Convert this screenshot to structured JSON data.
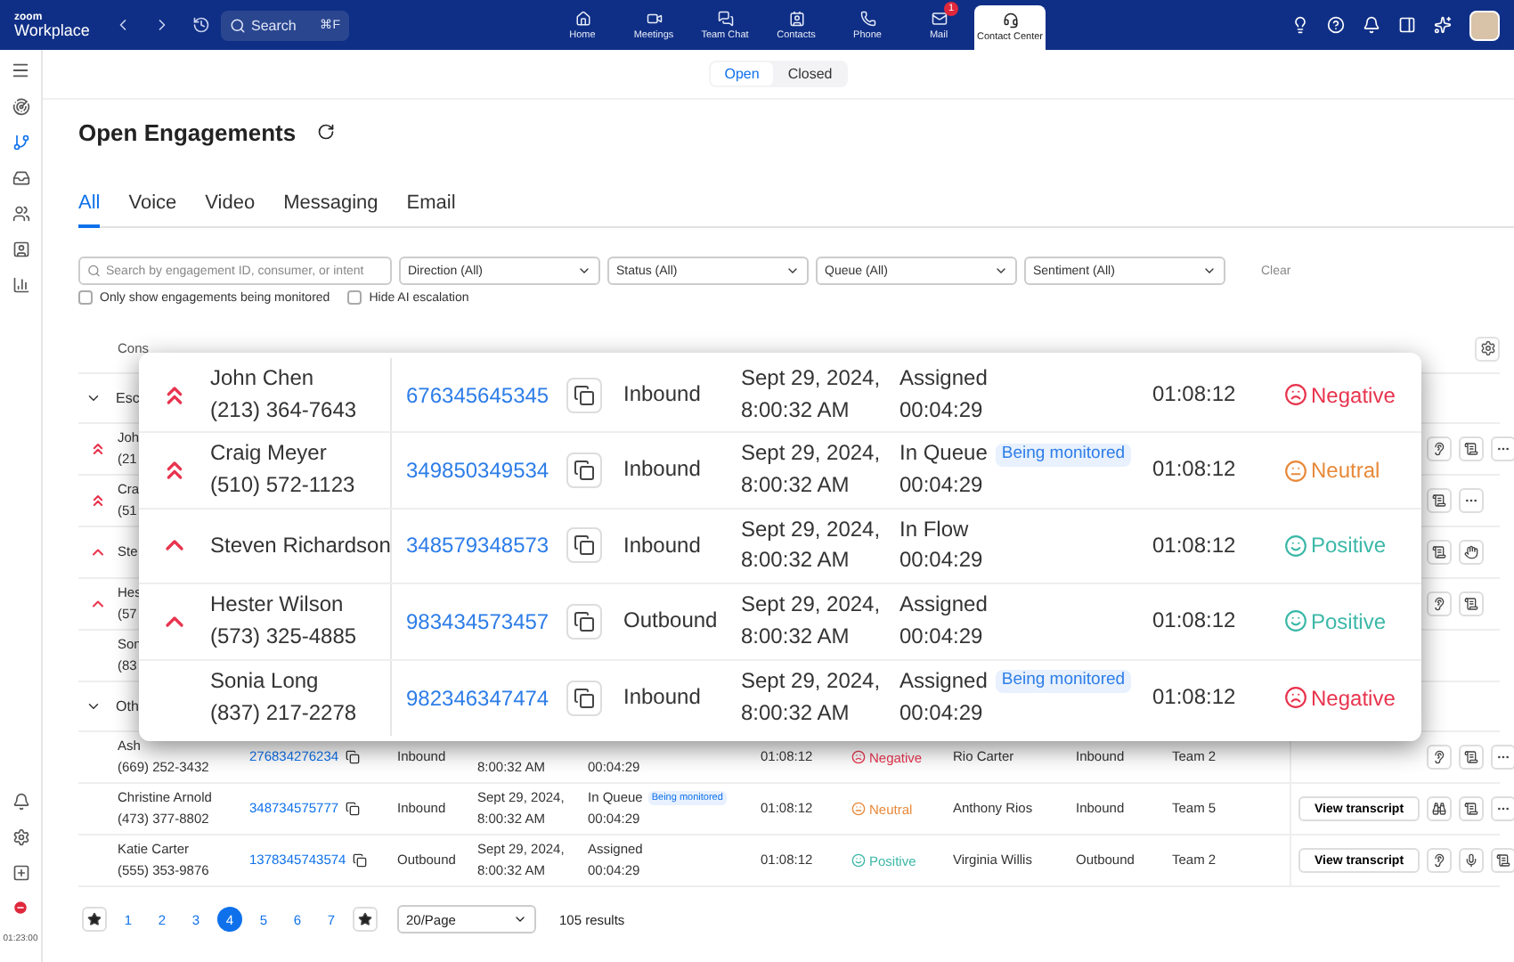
{
  "topbar": {
    "logo_top": "zoom",
    "logo_bottom": "Workplace",
    "search": {
      "placeholder": "Search",
      "shortcut": "⌘F"
    },
    "nav": [
      {
        "label": "Home",
        "selected": false
      },
      {
        "label": "Meetings",
        "selected": false
      },
      {
        "label": "Team Chat",
        "selected": false
      },
      {
        "label": "Contacts",
        "selected": false
      },
      {
        "label": "Phone",
        "selected": false
      },
      {
        "label": "Mail",
        "selected": false,
        "badge": "1"
      },
      {
        "label": "Contact Center",
        "selected": true
      }
    ]
  },
  "sidebar": {
    "items": [
      {
        "selected": false
      },
      {
        "selected": true
      },
      {
        "selected": false
      },
      {
        "selected": false
      },
      {
        "selected": false
      },
      {
        "selected": false
      }
    ],
    "status_time": "01:23:00"
  },
  "view_toggle": [
    {
      "label": "Open",
      "selected": true
    },
    {
      "label": "Closed",
      "selected": false
    }
  ],
  "title": "Open Engagements",
  "tabs": [
    {
      "label": "All",
      "selected": true
    },
    {
      "label": "Voice",
      "selected": false
    },
    {
      "label": "Video",
      "selected": false
    },
    {
      "label": "Messaging",
      "selected": false
    },
    {
      "label": "Email",
      "selected": false
    }
  ],
  "filters": {
    "search": {
      "placeholder": "Search by engagement ID, consumer, or intent"
    },
    "dropdowns": [
      "Direction (All)",
      "Status (All)",
      "Queue (All)",
      "Sentiment (All)"
    ],
    "clear": "Clear"
  },
  "checkboxes": [
    {
      "label": "Only show engagements being monitored",
      "checked": false
    },
    {
      "label": "Hide AI escalation",
      "checked": false
    }
  ],
  "table": {
    "header": "Cons",
    "rows": [
      {
        "kind": "group",
        "label": "Esc",
        "expanded": true
      },
      {
        "kind": "engagement",
        "priority": {
          "kind": "double"
        },
        "name": "Joh",
        "phone": "(21",
        "actions": [
          {
            "kind": "ear"
          },
          {
            "kind": "transcript"
          },
          {
            "kind": "more"
          }
        ]
      },
      {
        "kind": "engagement",
        "priority": {
          "kind": "double"
        },
        "name": "Cra",
        "phone": "(51",
        "actions": [
          {
            "kind": "transcript"
          },
          {
            "kind": "more"
          }
        ]
      },
      {
        "kind": "engagement",
        "priority": {
          "kind": "single"
        },
        "name": "Ste",
        "actions": [
          {
            "kind": "transcript"
          },
          {
            "kind": "hand"
          }
        ]
      },
      {
        "kind": "engagement",
        "priority": {
          "kind": "single"
        },
        "name": "Hes",
        "phone": "(57",
        "actions": [
          {
            "kind": "ear"
          },
          {
            "kind": "transcript"
          }
        ]
      },
      {
        "kind": "engagement",
        "name": "Son",
        "phone": "(83"
      },
      {
        "kind": "group",
        "label": "Oth",
        "expanded": true
      },
      {
        "kind": "engagement",
        "name": "Ash",
        "phone": "(669) 252-3432",
        "id": "276834276234",
        "direction": "Inbound",
        "date2": "8:00:32 AM",
        "status_time": "00:04:29",
        "duration": "01:08:12",
        "sentiment": {
          "kind": "negative",
          "label": "Negative"
        },
        "agent": "Rio Carter",
        "direction2": "Inbound",
        "team": "Team 2",
        "actions": [
          {
            "kind": "ear"
          },
          {
            "kind": "transcript"
          },
          {
            "kind": "more"
          }
        ]
      },
      {
        "kind": "engagement",
        "name": "Christine Arnold",
        "phone": "(473) 377-8802",
        "id": "348734575777",
        "direction": "Inbound",
        "date1": "Sept 29, 2024,",
        "date2": "8:00:32 AM",
        "status": "In Queue",
        "badge": "Being monitored",
        "status_time": "00:04:29",
        "duration": "01:08:12",
        "sentiment": {
          "kind": "neutral",
          "label": "Neutral"
        },
        "agent": "Anthony Rios",
        "direction2": "Inbound",
        "team": "Team 5",
        "actions": [
          {
            "kind": "button",
            "label": "View transcript"
          },
          {
            "kind": "binoculars"
          },
          {
            "kind": "transcript"
          },
          {
            "kind": "more"
          }
        ]
      },
      {
        "kind": "engagement",
        "name": "Katie Carter",
        "phone": "(555) 353-9876",
        "id": "1378345743574",
        "direction": "Outbound",
        "date1": "Sept 29, 2024,",
        "date2": "8:00:32 AM",
        "status": "Assigned",
        "status_time": "00:04:29",
        "duration": "01:08:12",
        "sentiment": {
          "kind": "positive",
          "label": "Positive"
        },
        "agent": "Virginia Willis",
        "direction2": "Outbound",
        "team": "Team 2",
        "actions": [
          {
            "kind": "button",
            "label": "View transcript"
          },
          {
            "kind": "ear"
          },
          {
            "kind": "mic"
          },
          {
            "kind": "transcript"
          }
        ]
      }
    ]
  },
  "popup": {
    "rows": [
      {
        "kind": "double",
        "name": "John Chen",
        "phone": "(213) 364-7643",
        "id": "676345645345",
        "direction": "Inbound",
        "date1": "Sept 29, 2024,",
        "date2": "8:00:32 AM",
        "status": "Assigned",
        "status_time": "00:04:29",
        "duration": "01:08:12",
        "sentiment": {
          "kind": "negative",
          "label": "Negative"
        }
      },
      {
        "kind": "double",
        "name": "Craig Meyer",
        "phone": "(510) 572-1123",
        "id": "349850349534",
        "direction": "Inbound",
        "date1": "Sept 29, 2024,",
        "date2": "8:00:32 AM",
        "status": "In Queue",
        "badge": "Being monitored",
        "status_time": "00:04:29",
        "duration": "01:08:12",
        "sentiment": {
          "kind": "neutral",
          "label": "Neutral"
        }
      },
      {
        "kind": "single",
        "name": "Steven Richardson",
        "id": "348579348573",
        "direction": "Inbound",
        "date1": "Sept 29, 2024,",
        "date2": "8:00:32 AM",
        "status": "In Flow",
        "status_time": "00:04:29",
        "duration": "01:08:12",
        "sentiment": {
          "kind": "positive",
          "label": "Positive"
        }
      },
      {
        "kind": "single",
        "name": "Hester Wilson",
        "phone": "(573) 325-4885",
        "id": "983434573457",
        "direction": "Outbound",
        "date1": "Sept 29, 2024,",
        "date2": "8:00:32 AM",
        "status": "Assigned",
        "status_time": "00:04:29",
        "duration": "01:08:12",
        "sentiment": {
          "kind": "positive",
          "label": "Positive"
        }
      },
      {
        "kind": "none",
        "name": "Sonia Long",
        "phone": "(837) 217-2278",
        "id": "982346347474",
        "direction": "Inbound",
        "date1": "Sept 29, 2024,",
        "date2": "8:00:32 AM",
        "status": "Assigned",
        "badge": "Being monitored",
        "status_time": "00:04:29",
        "duration": "01:08:12",
        "sentiment": {
          "kind": "negative",
          "label": "Negative"
        }
      }
    ]
  },
  "pagination": {
    "pages": [
      {
        "label": "1",
        "selected": false
      },
      {
        "label": "2",
        "selected": false
      },
      {
        "label": "3",
        "selected": false
      },
      {
        "label": "4",
        "selected": true
      },
      {
        "label": "5",
        "selected": false
      },
      {
        "label": "6",
        "selected": false
      },
      {
        "label": "7",
        "selected": false
      }
    ],
    "page_size": "20/Page",
    "results": "105 results"
  }
}
